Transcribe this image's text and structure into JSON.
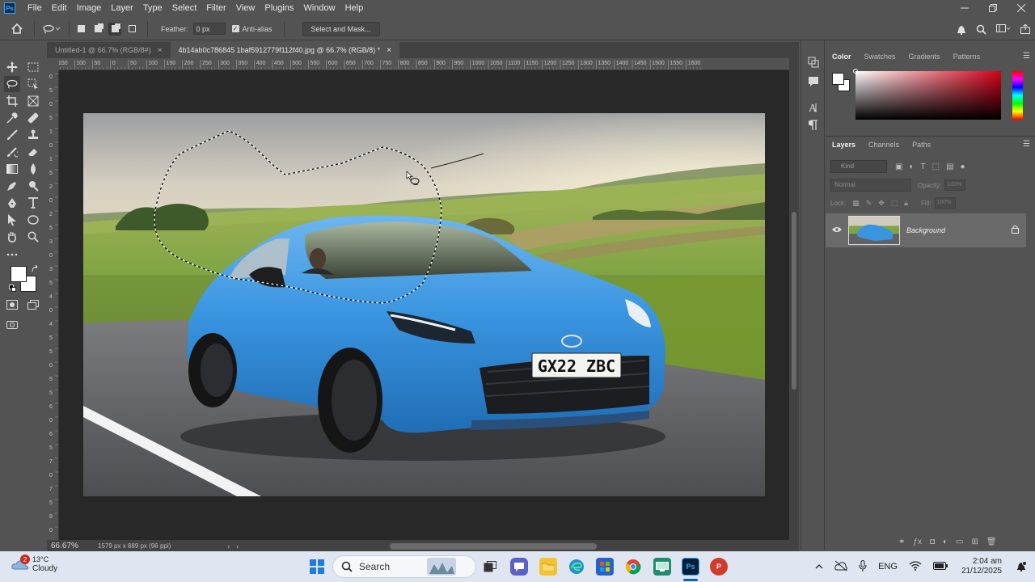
{
  "menu": {
    "logo": "Ps",
    "items": [
      "File",
      "Edit",
      "Image",
      "Layer",
      "Type",
      "Select",
      "Filter",
      "View",
      "Plugins",
      "Window",
      "Help"
    ]
  },
  "options": {
    "feather_label": "Feather:",
    "feather_value": "0 px",
    "antialias_label": "Anti-alias",
    "select_mask_label": "Select and Mask..."
  },
  "tabs": [
    {
      "label": "Untitled-1 @ 66.7% (RGB/8#)",
      "active": false
    },
    {
      "label": "4b14ab0c786845 1baf5912779f112f40.jpg @ 66.7% (RGB/8) *",
      "active": true
    }
  ],
  "ruler": {
    "h_labels": [
      "150",
      "100",
      "50",
      "0",
      "50",
      "100",
      "150",
      "200",
      "250",
      "300",
      "350",
      "400",
      "450",
      "500",
      "550",
      "600",
      "650",
      "700",
      "750",
      "800",
      "850",
      "900",
      "950",
      "1000",
      "1050",
      "1100",
      "1150",
      "1200",
      "1250",
      "1300",
      "1350",
      "1400",
      "1450",
      "1500",
      "1550",
      "1600"
    ],
    "v_labels": [
      "0",
      "5",
      "0",
      "5",
      "1",
      "0",
      "1",
      "5",
      "2",
      "0",
      "2",
      "5",
      "3",
      "0",
      "3",
      "5",
      "4",
      "0",
      "4",
      "5",
      "5",
      "0",
      "5",
      "5",
      "6",
      "0",
      "6",
      "5",
      "7",
      "0",
      "7",
      "5",
      "8",
      "0"
    ]
  },
  "photo": {
    "plate": "GX22 ZBC",
    "colors": {
      "car": "#3a95e0",
      "sky": "#d7d2c5",
      "grass": "#7fa443",
      "road": "#5d5f62"
    }
  },
  "status": {
    "zoom": "66.67%",
    "doc_info": "1579 px x 889 px (96 ppi)"
  },
  "color_panel": {
    "tabs": [
      "Color",
      "Swatches",
      "Gradients",
      "Patterns"
    ],
    "fg": "#ffffff",
    "bg": "#ffffff"
  },
  "layers_panel": {
    "tabs": [
      "Layers",
      "Channels",
      "Paths"
    ],
    "filter_kind": "Kind",
    "blend_mode": "Normal",
    "opacity_label": "Opacity:",
    "opacity_value": "100%",
    "lock_label": "Lock:",
    "fill_label": "Fill:",
    "fill_value": "100%",
    "layer_name": "Background"
  },
  "taskbar": {
    "weather_badge": "2",
    "temperature": "13°C",
    "condition": "Cloudy",
    "search_label": "Search",
    "language": "ENG",
    "time": "2:04 am",
    "date": "21/12/2025"
  },
  "icons": {
    "home": "home-icon",
    "lasso": "lasso-icon",
    "bell": "bell-icon",
    "search": "search-icon",
    "workspace": "workspace-icon",
    "share": "share-icon"
  }
}
